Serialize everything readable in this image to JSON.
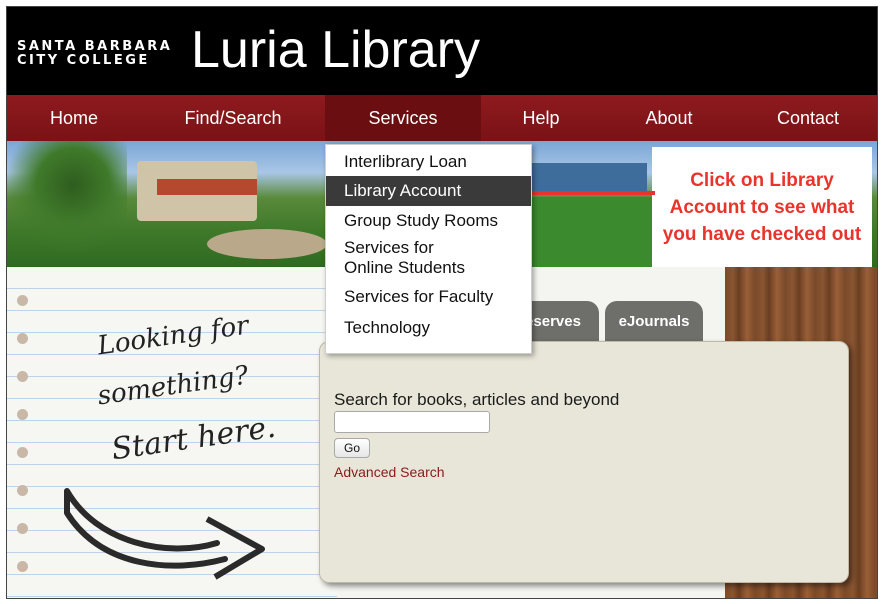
{
  "header": {
    "college_line1": "SANTA BARBARA",
    "college_line2": "CITY COLLEGE",
    "library_name": "Luria Library"
  },
  "nav": {
    "items": [
      {
        "label": "Home"
      },
      {
        "label": "Find/Search"
      },
      {
        "label": "Services"
      },
      {
        "label": "Help"
      },
      {
        "label": "About"
      },
      {
        "label": "Contact"
      }
    ],
    "active": "Services"
  },
  "services_menu": {
    "items": [
      {
        "label": "Interlibrary Loan"
      },
      {
        "label": "Library Account"
      },
      {
        "label": "Group Study Rooms"
      },
      {
        "label": "Services for Online Students"
      },
      {
        "label": "Services for Faculty"
      },
      {
        "label": "Technology"
      }
    ],
    "highlighted": "Library Account"
  },
  "callout": {
    "text": "Click on Library Account to see what you have checked out",
    "color": "#e8352b"
  },
  "handwriting": {
    "line1": "Looking for",
    "line2": "something?",
    "line3": "Start here."
  },
  "tabs": [
    {
      "label": "eserves"
    },
    {
      "label": "eJournals"
    }
  ],
  "search": {
    "label": "Search for books, articles and beyond",
    "input_value": "",
    "go_label": "Go",
    "advanced_label": "Advanced Search"
  },
  "colors": {
    "nav_bg": "#8e1a1e",
    "nav_active": "#6a0e12",
    "link": "#8b1a1a",
    "panel_bg": "#e8e6d8"
  }
}
